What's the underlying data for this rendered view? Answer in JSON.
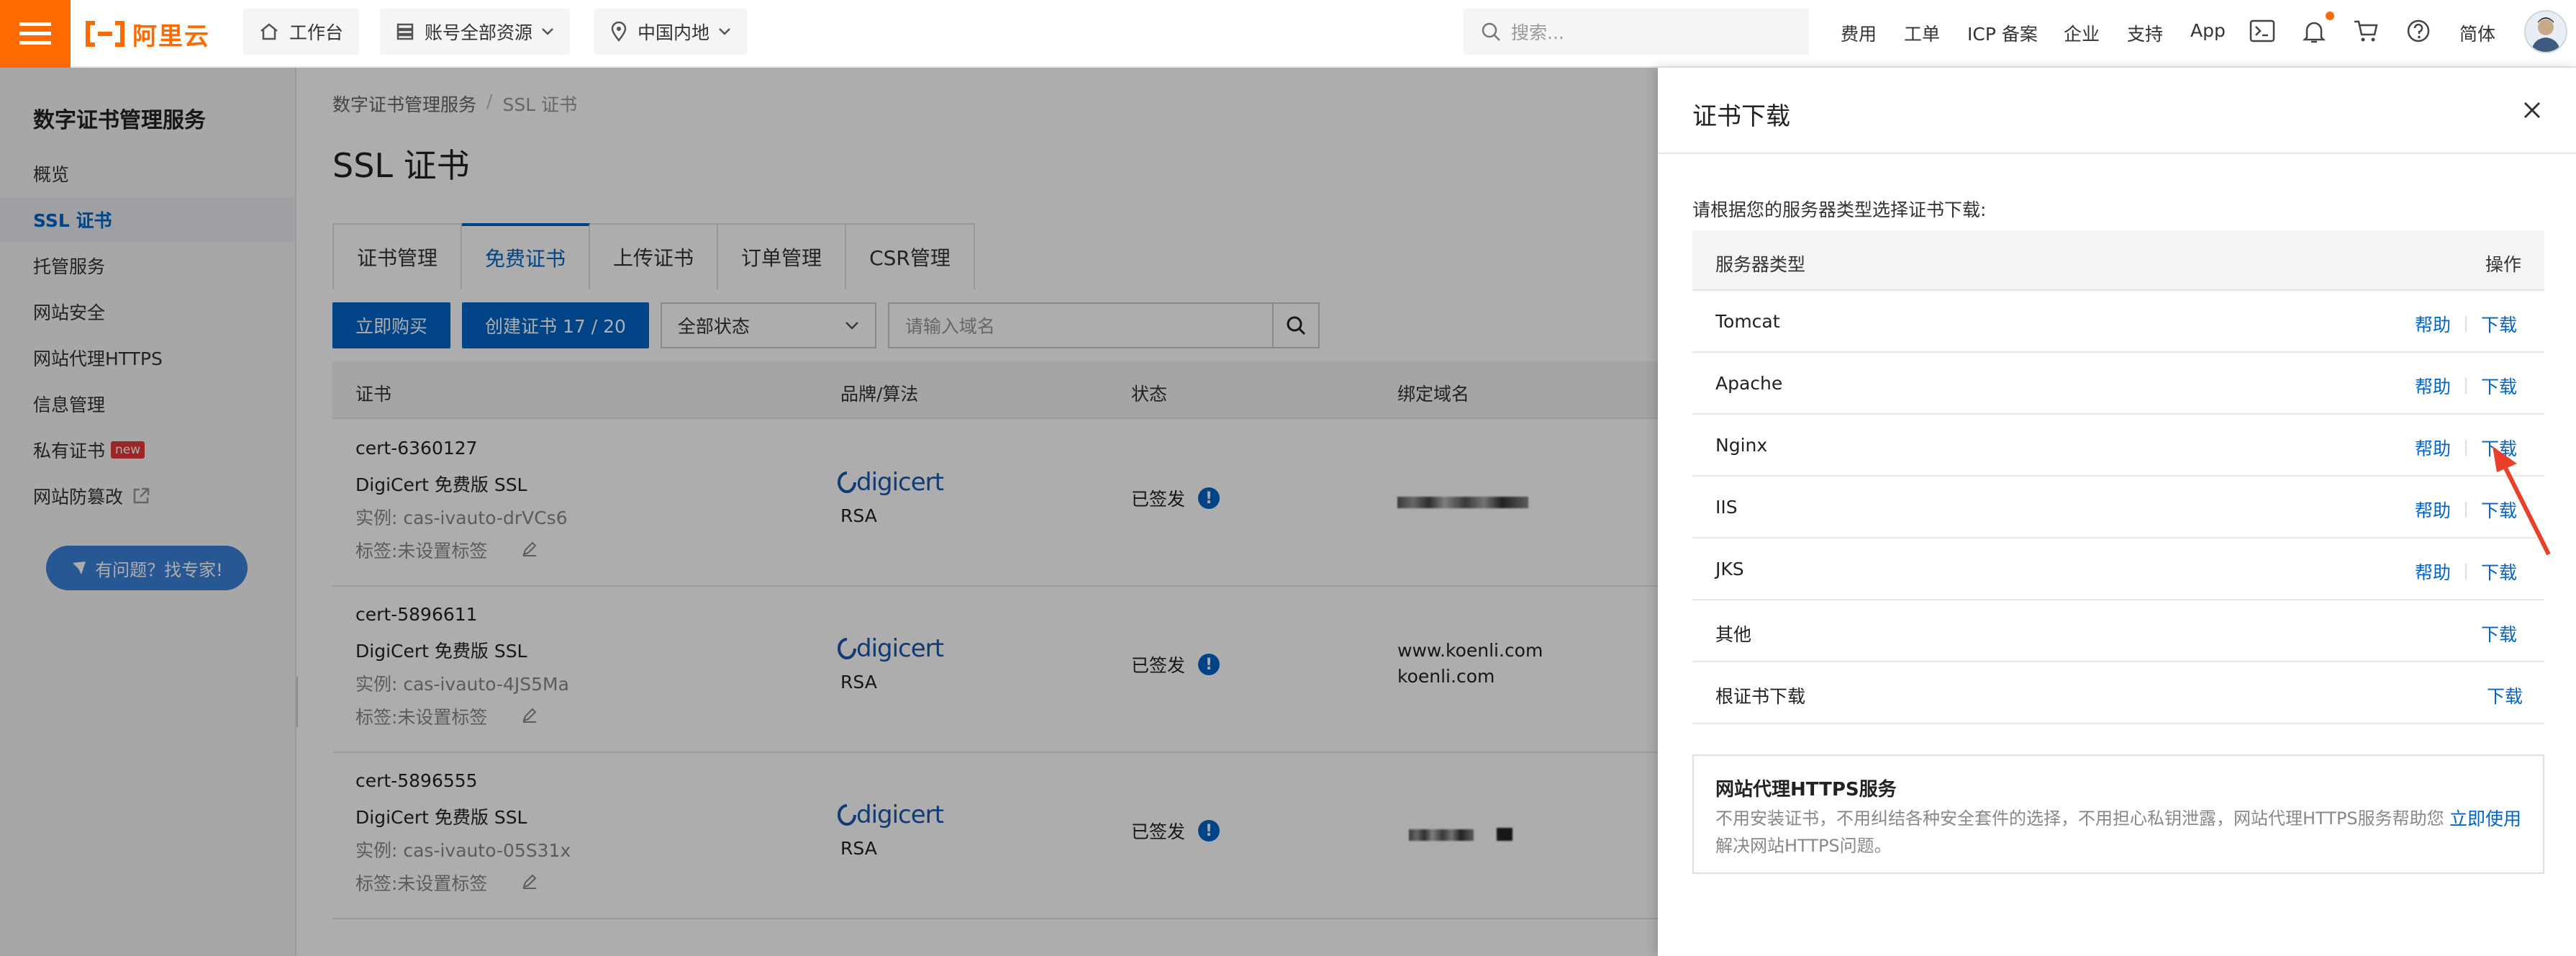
{
  "topbar": {
    "logo_text": "阿里云",
    "workbench": "工作台",
    "account_scope": "账号全部资源",
    "region": "中国内地",
    "search_placeholder": "搜索...",
    "links": [
      "费用",
      "工单",
      "ICP 备案",
      "企业",
      "支持",
      "App"
    ],
    "language": "简体",
    "accent_color": "#ff6a00"
  },
  "sidebar": {
    "title": "数字证书管理服务",
    "items": [
      {
        "label": "概览"
      },
      {
        "label": "SSL 证书"
      },
      {
        "label": "托管服务"
      },
      {
        "label": "网站安全"
      },
      {
        "label": "网站代理HTTPS"
      },
      {
        "label": "信息管理"
      },
      {
        "label": "私有证书",
        "badge": "new"
      },
      {
        "label": "网站防篡改"
      }
    ],
    "help_button": "有问题？找专家!"
  },
  "main": {
    "breadcrumb": [
      "数字证书管理服务",
      "SSL 证书"
    ],
    "title": "SSL 证书",
    "tabs": [
      "证书管理",
      "免费证书",
      "上传证书",
      "订单管理",
      "CSR管理"
    ],
    "toolbar": {
      "buy": "立即购买",
      "create": "创建证书 17 / 20",
      "status_filter": "全部状态",
      "domain_placeholder": "请输入域名"
    },
    "columns": [
      "证书",
      "品牌/算法",
      "状态",
      "绑定域名"
    ],
    "rows": [
      {
        "id": "cert-6360127",
        "product": "DigiCert 免费版 SSL",
        "instance": "实例: cas-ivauto-drVCs6",
        "tag": "标签:未设置标签",
        "brand": "digicert",
        "algo": "RSA",
        "status": "已签发",
        "domains": []
      },
      {
        "id": "cert-5896611",
        "product": "DigiCert 免费版 SSL",
        "instance": "实例: cas-ivauto-4JS5Ma",
        "tag": "标签:未设置标签",
        "brand": "digicert",
        "algo": "RSA",
        "status": "已签发",
        "domains": [
          "www.koenli.com",
          "koenli.com"
        ]
      },
      {
        "id": "cert-5896555",
        "product": "DigiCert 免费版 SSL",
        "instance": "实例: cas-ivauto-05S31x",
        "tag": "标签:未设置标签",
        "brand": "digicert",
        "algo": "RSA",
        "status": "已签发",
        "domains": []
      }
    ],
    "primary_color": "#0064c8"
  },
  "drawer": {
    "title": "证书下载",
    "hint": "请根据您的服务器类型选择证书下载:",
    "col_server": "服务器类型",
    "col_action": "操作",
    "help_label": "帮助",
    "download_label": "下载",
    "servers": [
      {
        "name": "Tomcat",
        "help": true
      },
      {
        "name": "Apache",
        "help": true
      },
      {
        "name": "Nginx",
        "help": true
      },
      {
        "name": "IIS",
        "help": true
      },
      {
        "name": "JKS",
        "help": true
      },
      {
        "name": "其他",
        "help": false
      },
      {
        "name": "根证书下载",
        "help": false
      }
    ],
    "promo": {
      "title": "网站代理HTTPS服务",
      "desc": "不用安装证书，不用纠结各种安全套件的选择，不用担心私钥泄露，网站代理HTTPS服务帮助您解决网站HTTPS问题。",
      "link": "立即使用"
    }
  }
}
